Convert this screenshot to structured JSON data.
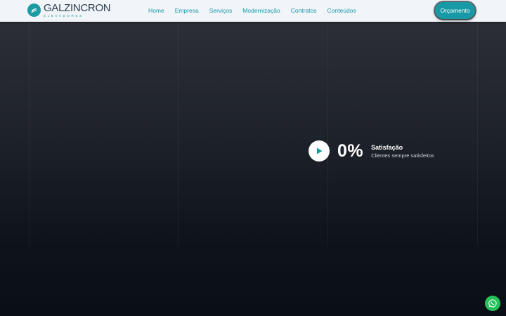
{
  "brand": {
    "name": "GALZINCRON",
    "tagline": "ELEVADORES",
    "color": "#1b9aa3"
  },
  "nav": {
    "items": [
      {
        "label": "Home"
      },
      {
        "label": "Empresa"
      },
      {
        "label": "Serviços"
      },
      {
        "label": "Modernização"
      },
      {
        "label": "Contratos"
      },
      {
        "label": "Conteúdos"
      }
    ]
  },
  "cta": {
    "label": "Orçamento"
  },
  "hero": {
    "play_icon": "play-icon",
    "stat": {
      "value": "0%",
      "title": "Satisfação",
      "subtitle": "Clientes sempre satisfeitos"
    }
  },
  "floating": {
    "whatsapp_icon": "whatsapp-icon",
    "color": "#25c25a"
  }
}
